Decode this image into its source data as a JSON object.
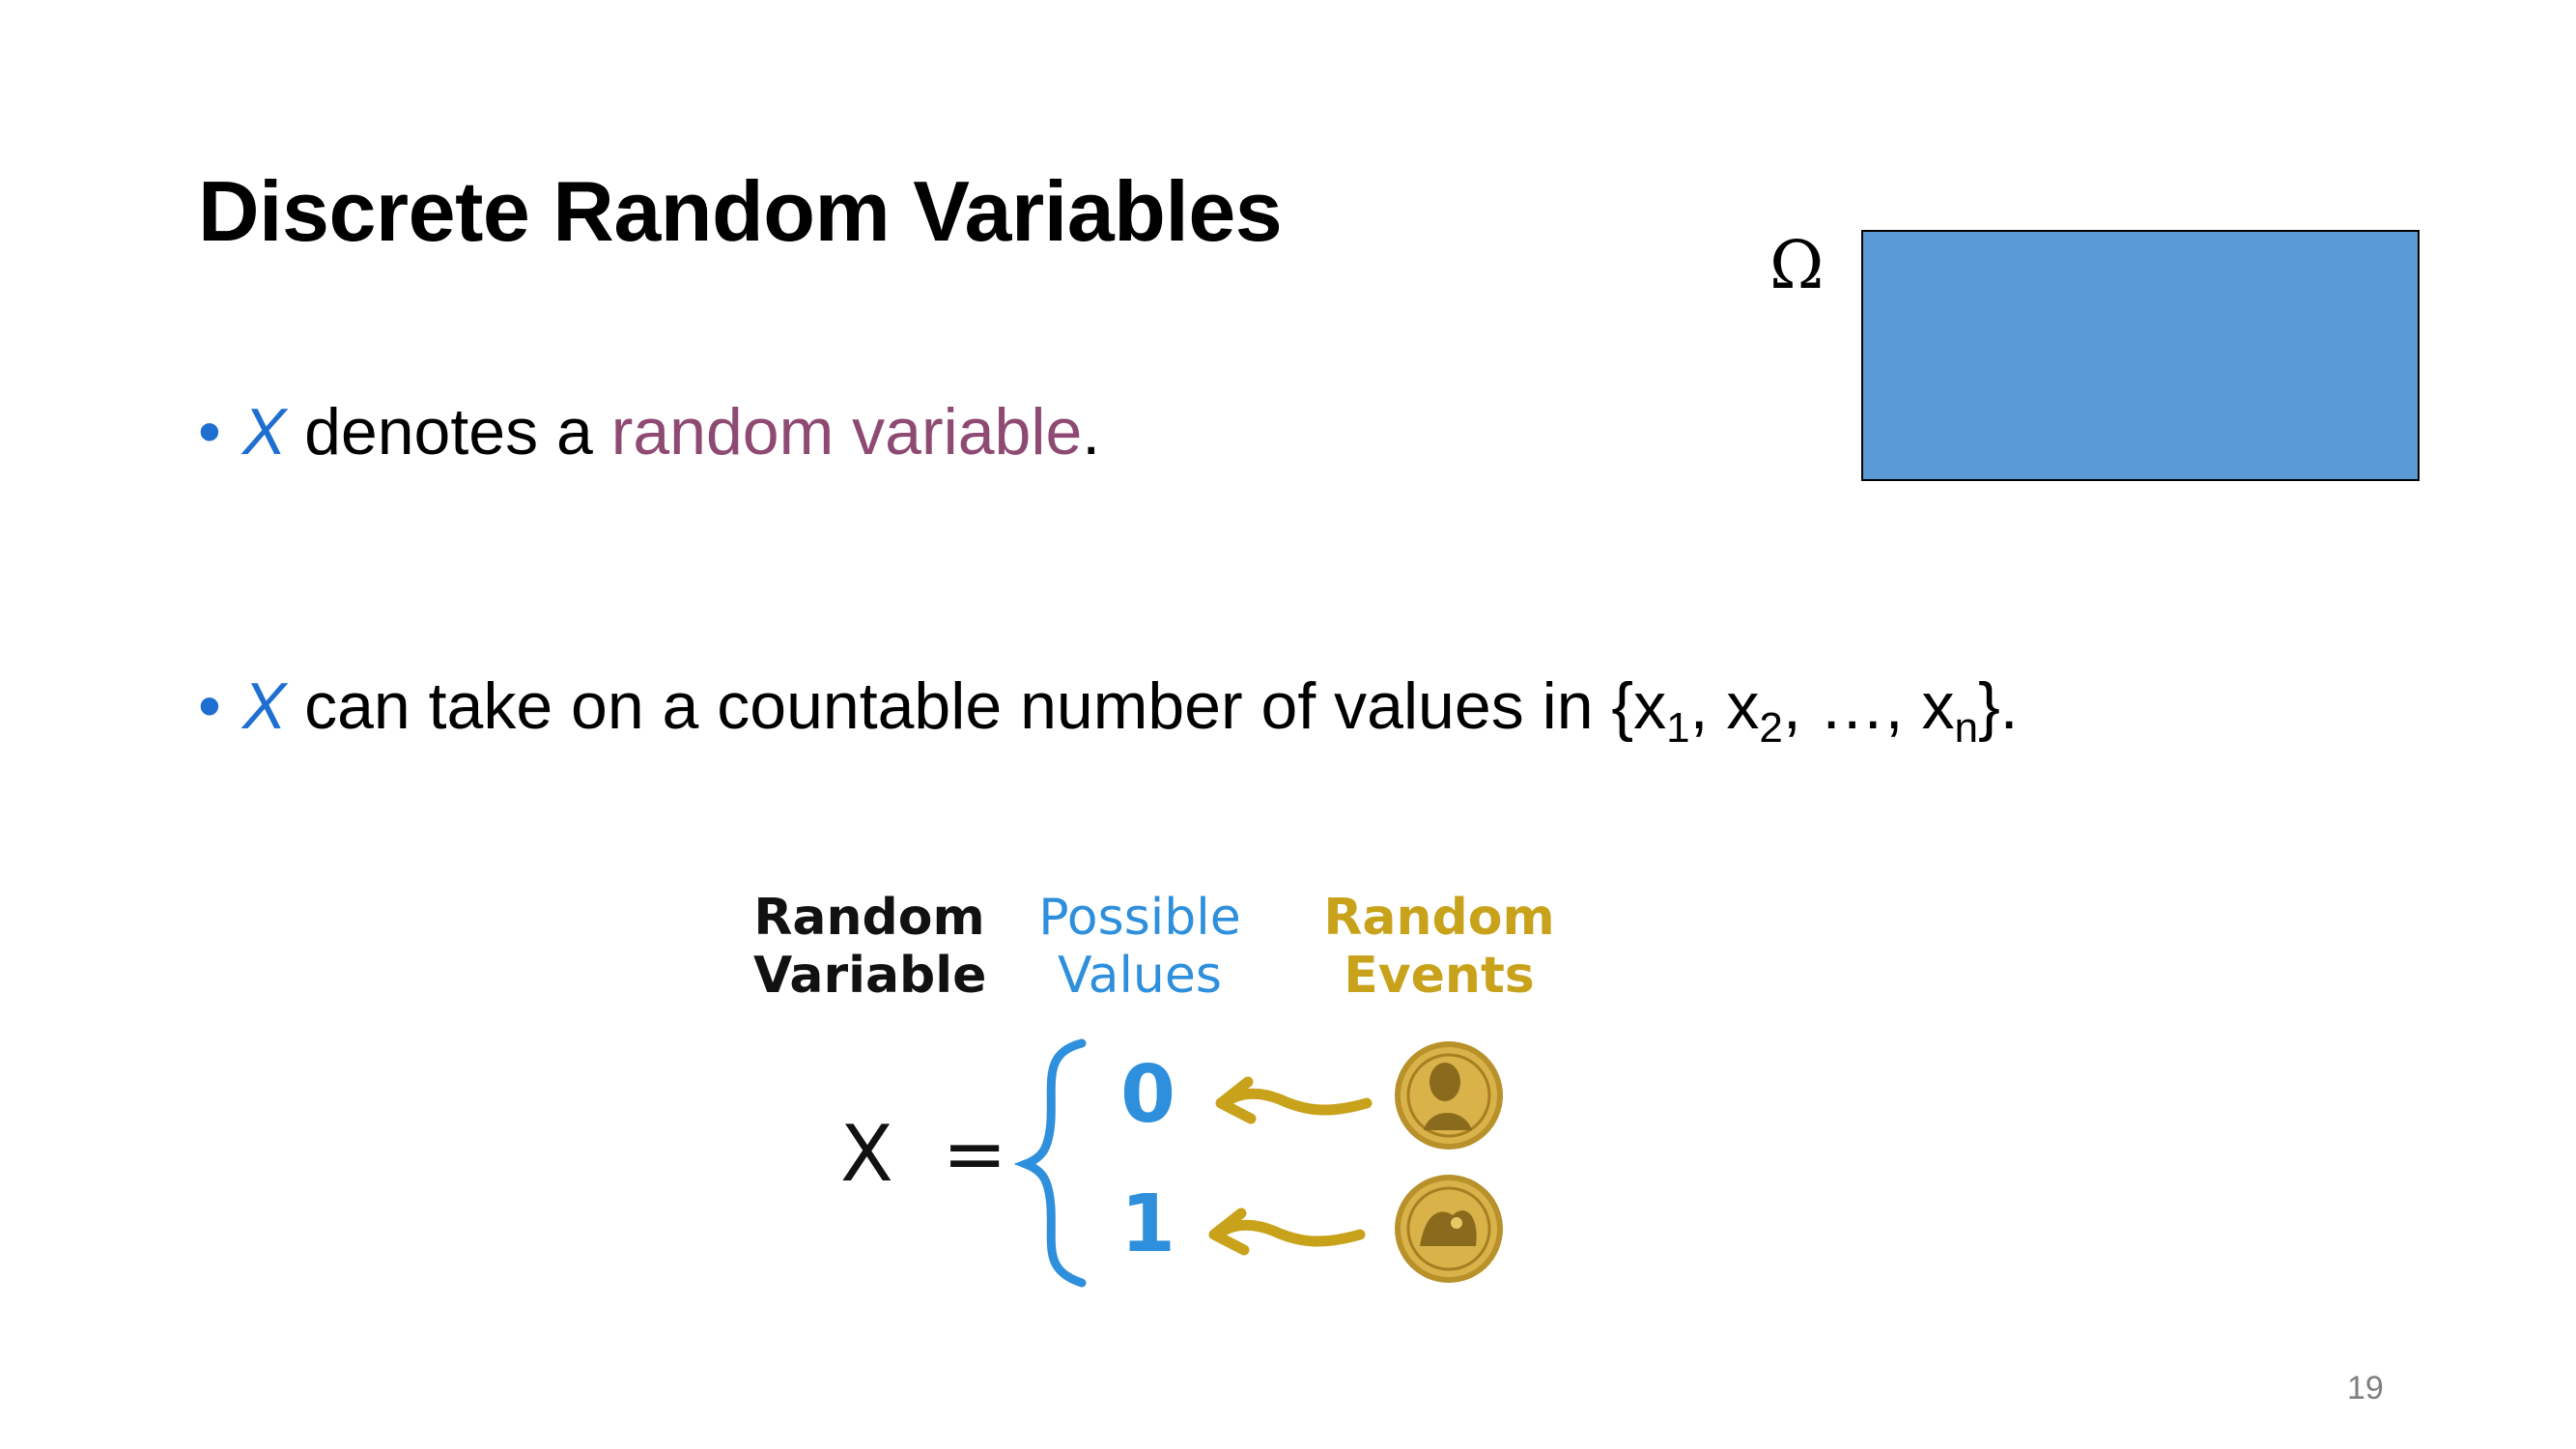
{
  "slide": {
    "title": "Discrete Random Variables",
    "bullets": [
      {
        "var": "X",
        "text_before": "denotes a",
        "term": "random variable",
        "text_after": "."
      },
      {
        "var": "X",
        "text_before": "can take on a countable number of values in {x",
        "sub1": "1",
        "mid1": ", x",
        "sub2": "2",
        "mid2": ", …, x",
        "subn": "n",
        "text_after": "}."
      }
    ],
    "omega_label": "Ω",
    "page_number": "19"
  },
  "figure": {
    "header_random_variable": "Random\nVariable",
    "header_possible_values": "Possible\nValues",
    "header_random_events": "Random\nEvents",
    "lhs": "X  =",
    "values": [
      "0",
      "1"
    ],
    "coins": [
      "coin-heads-icon",
      "coin-tails-icon"
    ]
  },
  "colors": {
    "accent_blue": "#1f6fd1",
    "term_purple": "#8e4a73",
    "omega_fill": "#5b9bd5",
    "figure_blue": "#2e8fdc",
    "figure_gold": "#c9a21b"
  }
}
